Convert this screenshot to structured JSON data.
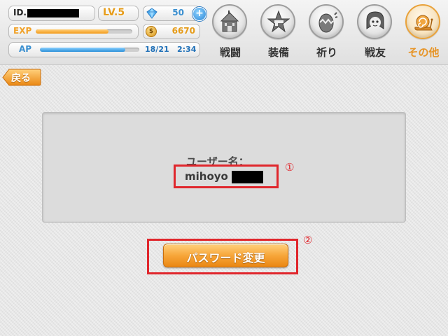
{
  "status": {
    "id_label": "ID.",
    "level": "LV.5",
    "exp_label": "EXP",
    "exp_progress": 0.75,
    "gems": "50",
    "coins": "6670",
    "coin_symbol": "$",
    "ap_label": "AP",
    "ap_value": "18/21",
    "ap_progress": 0.857,
    "ap_timer": "2:34",
    "add_symbol": "+"
  },
  "nav": {
    "items": [
      {
        "label": "戦闘",
        "icon": "castle-icon"
      },
      {
        "label": "装備",
        "icon": "star-gun-icon"
      },
      {
        "label": "祈り",
        "icon": "egg-icon"
      },
      {
        "label": "戦友",
        "icon": "girl-face-icon"
      },
      {
        "label": "その他",
        "icon": "snail-icon",
        "active": true
      }
    ]
  },
  "back_button": {
    "label": "戻る"
  },
  "account": {
    "username_label": "ユーザー名：",
    "username_value": "mihoyo"
  },
  "change_password_button": {
    "label": "パスワード変更"
  },
  "annotations": {
    "marker_1": "①",
    "marker_2": "②",
    "color": "#e0262c"
  },
  "colors": {
    "accent_orange": "#f7a63a",
    "ap_blue": "#2a8fd8",
    "active_nav": "#e79426"
  }
}
